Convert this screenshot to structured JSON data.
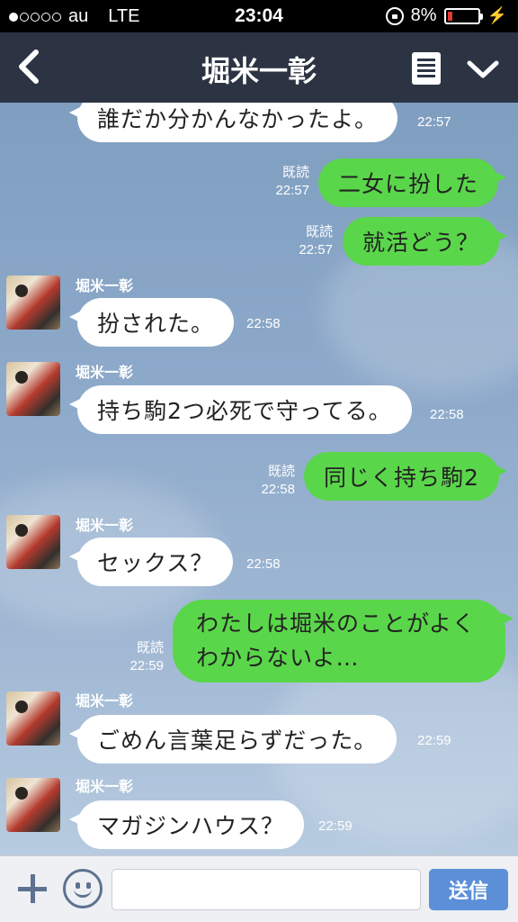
{
  "status_bar": {
    "carrier": "au",
    "network": "LTE",
    "time": "23:04",
    "battery": "8%",
    "battery_icon": "battery-low-icon",
    "charging_icon": "bolt-icon"
  },
  "header": {
    "title": "堀米一彰",
    "back_icon": "chevron-left-icon",
    "menu_icon": "notes-icon",
    "more_icon": "chevron-down-icon"
  },
  "colors": {
    "header_bg": "#2c3444",
    "outgoing_bubble": "#5ad64a",
    "incoming_bubble": "#ffffff",
    "send_button": "#5b8fd8"
  },
  "messages": [
    {
      "dir": "in",
      "text": "誰だか分かんなかったよ。",
      "time": "22:57"
    },
    {
      "dir": "out",
      "text": "二女に扮した",
      "read": "既読",
      "time": "22:57"
    },
    {
      "dir": "out",
      "text": "就活どう？",
      "read": "既読",
      "time": "22:57"
    },
    {
      "dir": "in",
      "sender": "堀米一彰",
      "text": "扮された。",
      "time": "22:58"
    },
    {
      "dir": "in",
      "sender": "堀米一彰",
      "text": "持ち駒2つ必死で守ってる。",
      "time": "22:58"
    },
    {
      "dir": "out",
      "text": "同じく持ち駒2",
      "read": "既読",
      "time": "22:58"
    },
    {
      "dir": "in",
      "sender": "堀米一彰",
      "text": "セックス？",
      "time": "22:58"
    },
    {
      "dir": "out",
      "text": "わたしは堀米のことがよくわからないよ…",
      "read": "既読",
      "time": "22:59"
    },
    {
      "dir": "in",
      "sender": "堀米一彰",
      "text": "ごめん言葉足らずだった。",
      "time": "22:59"
    },
    {
      "dir": "in",
      "sender": "堀米一彰",
      "text": "マガジンハウス？",
      "time": "22:59"
    }
  ],
  "input_bar": {
    "plus_icon": "plus-icon",
    "sticker_icon": "smiley-icon",
    "placeholder": "",
    "send_label": "送信"
  }
}
